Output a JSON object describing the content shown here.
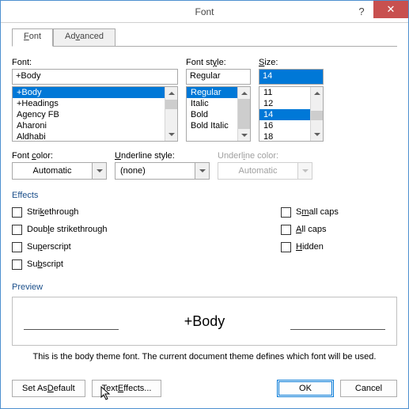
{
  "titlebar": {
    "title": "Font"
  },
  "tabs": {
    "font": "Font",
    "advanced": "Advanced"
  },
  "font": {
    "label": "Font:",
    "value": "+Body",
    "items": [
      "+Body",
      "+Headings",
      "Agency FB",
      "Aharoni",
      "Aldhabi"
    ]
  },
  "style": {
    "label": "Font style:",
    "value": "Regular",
    "items": [
      "Regular",
      "Italic",
      "Bold",
      "Bold Italic"
    ]
  },
  "size": {
    "label": "Size:",
    "value": "14",
    "items": [
      "11",
      "12",
      "14",
      "16",
      "18"
    ]
  },
  "color": {
    "label": "Font color:",
    "value": "Automatic"
  },
  "under": {
    "label": "Underline style:",
    "value": "(none)"
  },
  "ucolor": {
    "label": "Underline color:",
    "value": "Automatic"
  },
  "effects": {
    "group": "Effects",
    "strike": "Strikethrough",
    "dstrike": "Double strikethrough",
    "super": "Superscript",
    "sub": "Subscript",
    "small": "Small caps",
    "all": "All caps",
    "hidden": "Hidden"
  },
  "preview": {
    "group": "Preview",
    "text": "+Body",
    "desc": "This is the body theme font. The current document theme defines which font will be used."
  },
  "buttons": {
    "default": "Set As Default",
    "texteff": "Text Effects...",
    "ok": "OK",
    "cancel": "Cancel"
  }
}
